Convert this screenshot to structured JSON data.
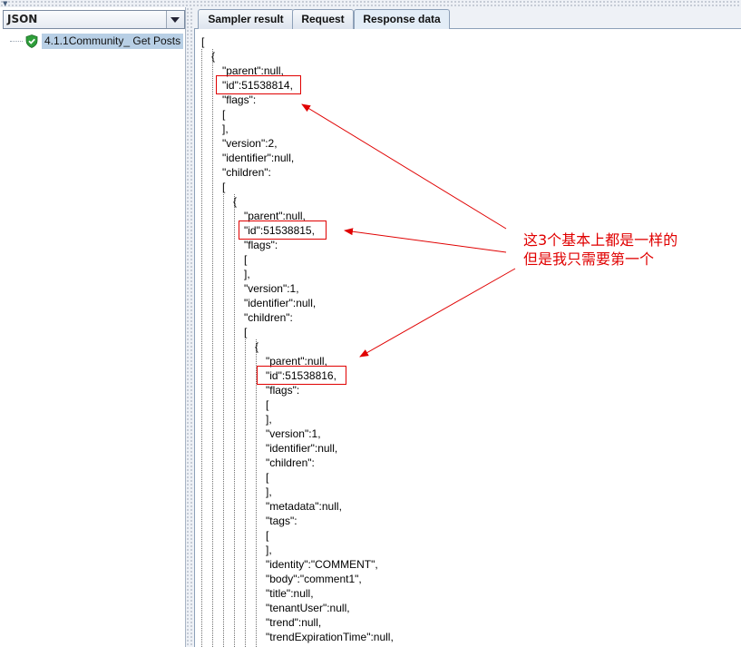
{
  "left_panel": {
    "combo_value": "JSON",
    "tree_item_label": "4.1.1Community_ Get Posts"
  },
  "tabs": [
    {
      "label": "Sampler result"
    },
    {
      "label": "Request"
    },
    {
      "label": "Response data"
    }
  ],
  "json_lines": [
    "[",
    "{",
    "\"parent\":null,",
    "\"id\":51538814,",
    "\"flags\":",
    "[",
    "],",
    "\"version\":2,",
    "\"identifier\":null,",
    "\"children\":",
    "[",
    "{",
    "\"parent\":null,",
    "\"id\":51538815,",
    "\"flags\":",
    "[",
    "],",
    "\"version\":1,",
    "\"identifier\":null,",
    "\"children\":",
    "[",
    "{",
    "\"parent\":null,",
    "\"id\":51538816,",
    "\"flags\":",
    "[",
    "],",
    "\"version\":1,",
    "\"identifier\":null,",
    "\"children\":",
    "[",
    "],",
    "\"metadata\":null,",
    "\"tags\":",
    "[",
    "],",
    "\"identity\":\"COMMENT\",",
    "\"body\":\"comment1\",",
    "\"title\":null,",
    "\"tenantUser\":null,",
    "\"trend\":null,",
    "\"trendExpirationTime\":null,"
  ],
  "annotation": {
    "line1": "这3个基本上都是一样的",
    "line2": "但是我只需要第一个"
  },
  "colors": {
    "annotation_red": "#e00000",
    "selection_blue": "#b8cfe5",
    "shield_green": "#2e9e3a"
  }
}
